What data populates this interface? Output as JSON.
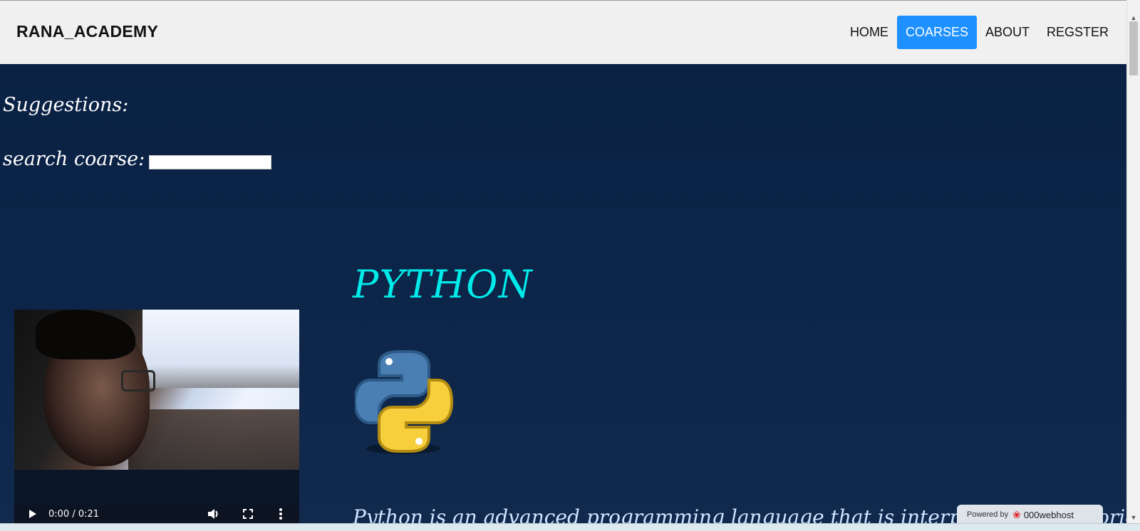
{
  "brand": "RANA_ACADEMY",
  "nav": {
    "items": [
      {
        "label": "HOME",
        "active": false
      },
      {
        "label": "COARSES",
        "active": true
      },
      {
        "label": "ABOUT",
        "active": false
      },
      {
        "label": "REGSTER",
        "active": false
      }
    ],
    "active_color": "#1e90ff"
  },
  "suggestions_label": "Suggestions:",
  "search": {
    "label": "search coarse:",
    "value": "",
    "placeholder": ""
  },
  "video": {
    "time": "0:00 / 0:21",
    "progress": 0
  },
  "course": {
    "title": "PYTHON",
    "title_color": "#00eaea",
    "logo_icon": "python-logo-icon",
    "description": "Python is an advanced programming language that is interpreted, object-oriented and"
  },
  "powered": {
    "prefix": "Powered by",
    "host": "000webhost"
  },
  "icons": {
    "play": "play-icon",
    "volume": "volume-icon",
    "fullscreen": "fullscreen-icon",
    "more": "more-vertical-icon"
  }
}
